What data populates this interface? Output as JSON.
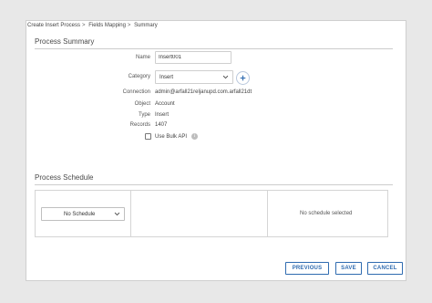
{
  "breadcrumb": {
    "items": [
      "Create Insert Process",
      "Fields Mapping",
      "Summary"
    ],
    "separator": ">"
  },
  "summary": {
    "title": "Process Summary",
    "name_label": "Name",
    "name_value": "Insert001",
    "category_label": "Category",
    "category_value": "Insert",
    "connection_label": "Connection",
    "connection_value": "admin@arfall21reljanupd.com.arfall21dt",
    "object_label": "Object",
    "object_value": "Account",
    "type_label": "Type",
    "type_value": "Insert",
    "records_label": "Records",
    "records_value": "1407",
    "bulk_api_label": "Use Bulk API",
    "bulk_api_checked": false,
    "info_glyph": "i"
  },
  "schedule": {
    "title": "Process Schedule",
    "select_value": "No Schedule",
    "empty_text": "No schedule selected"
  },
  "buttons": {
    "previous": "PREVIOUS",
    "save": "SAVE",
    "cancel": "CANCEL"
  },
  "colors": {
    "accent": "#2f6bb0",
    "add_button_border": "#b9c8dd"
  },
  "icons": {
    "category_dropdown": "chevron-down-icon",
    "add": "plus-icon",
    "info": "info-icon",
    "schedule_dropdown": "chevron-down-icon"
  }
}
